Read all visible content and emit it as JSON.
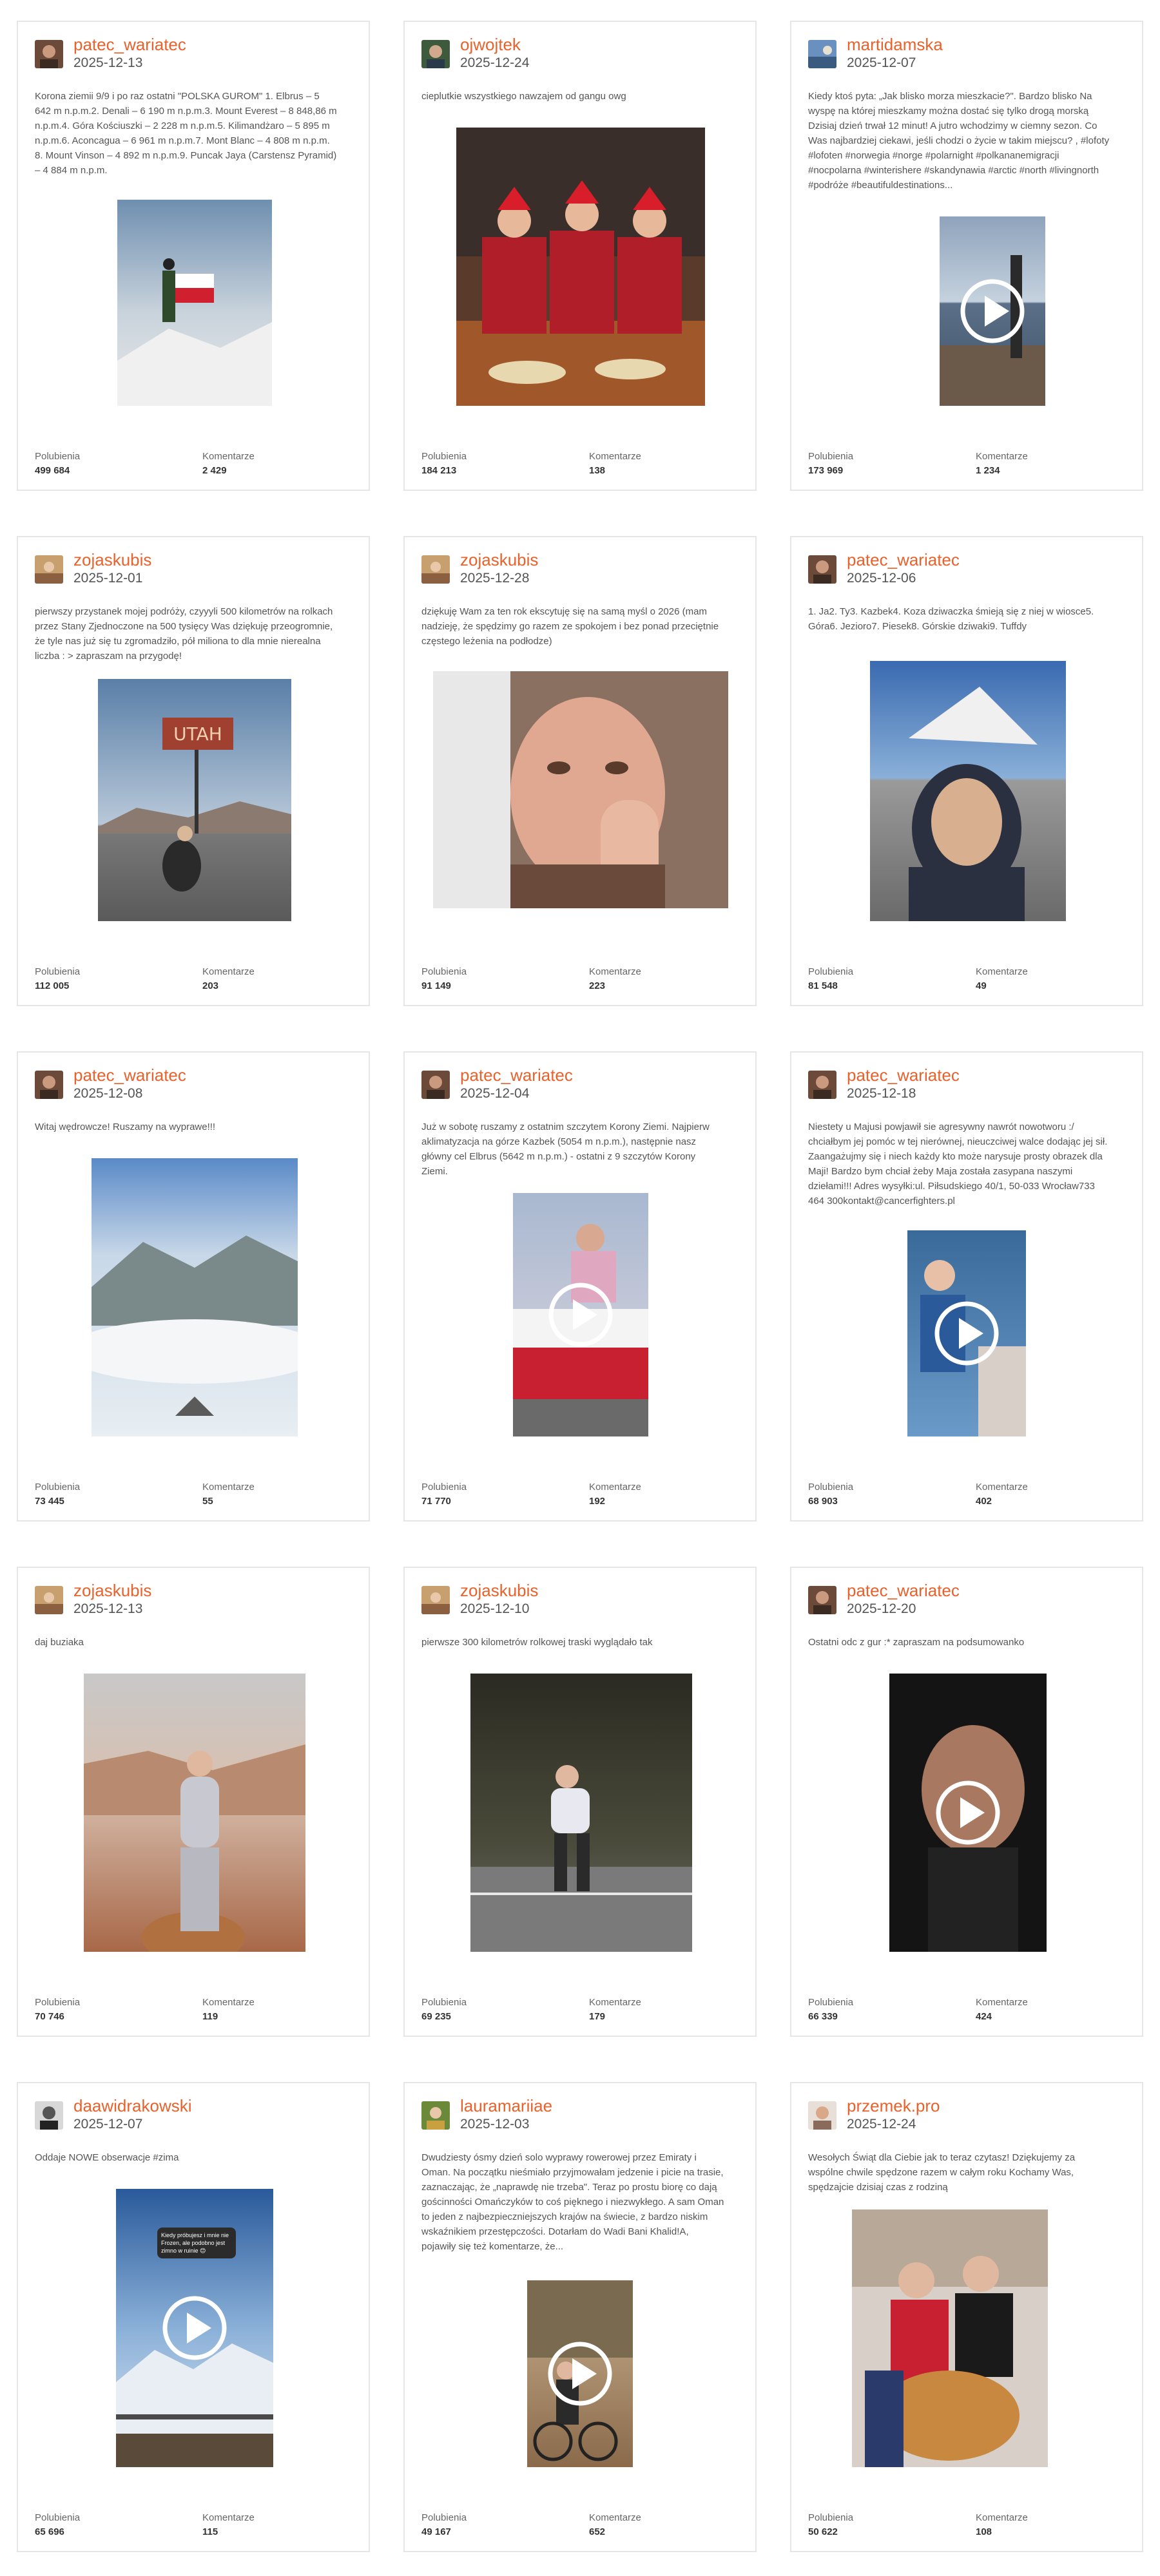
{
  "labels": {
    "likes": "Polubienia",
    "comments": "Komentarze"
  },
  "accent_color": "#e8622c",
  "play_icon": "play-icon",
  "posts": [
    {
      "username": "patec_wariatec",
      "date": "2025-12-13",
      "caption": "Korona ziemii 9/9 i po raz ostatni \"POLSKA GUROM\" 1. Elbrus – 5 642 m n.p.m.2. Denali – 6 190 m n.p.m.3. Mount Everest – 8 848,86 m n.p.m.4. Góra Kościuszki – 2 228 m n.p.m.5. Kilimandżaro – 5 895 m n.p.m.6. Aconcagua – 6 961 m n.p.m.7. Mont Blanc – 4 808 m n.p.m. 8. Mount Vinson – 4 892 m n.p.m.9. Puncak Jaya (Carstensz Pyramid) – 4 884 m n.p.m.",
      "likes": "499 684",
      "comments": "2 429"
    },
    {
      "username": "ojwojtek",
      "date": "2025-12-24",
      "caption": "cieplutkie wszystkiego nawzajem od gangu owg",
      "likes": "184 213",
      "comments": "138"
    },
    {
      "username": "martidamska",
      "date": "2025-12-07",
      "caption": "Kiedy ktoś pyta: „Jak blisko morza mieszkacie?\". Bardzo blisko Na wyspę na której mieszkamy można dostać się tylko drogą morską  Dzisiaj dzień trwał 12 minut! A jutro wchodzimy w ciemny sezon. Co Was najbardziej ciekawi, jeśli chodzi o życie w takim miejscu? , #lofoty #lofoten #norwegia #norge #polarnight #polkananemigracji #nocpolarna #winterishere #skandynawia #arctic #north #livingnorth #podróże #beautifuldestinations...",
      "likes": "173 969",
      "comments": "1 234"
    },
    {
      "username": "zojaskubis",
      "date": "2025-12-01",
      "caption": "pierwszy przystanek mojej podróży, czyyyli 500 kilometrów na rolkach przez Stany Zjednoczone na 500 tysięcy Was dziękuję przeogromnie, że tyle nas już się tu zgromadziło, pół miliona to dla mnie nierealna liczba : > zapraszam na przygodę!",
      "likes": "112 005",
      "comments": "203"
    },
    {
      "username": "zojaskubis",
      "date": "2025-12-28",
      "caption": "dziękuję Wam za ten rok ekscytuję się na samą myśl o 2026 (mam nadzieję, że spędzimy go razem ze spokojem i bez ponad przeciętnie częstego leżenia na podłodze)",
      "likes": "91 149",
      "comments": "223"
    },
    {
      "username": "patec_wariatec",
      "date": "2025-12-06",
      "caption": "1. Ja2. Ty3. Kazbek4. Koza dziwaczka śmieją się z niej w wiosce5. Góra6. Jezioro7. Piesek8. Górskie dziwaki9. Tuffdy",
      "likes": "81 548",
      "comments": "49"
    },
    {
      "username": "patec_wariatec",
      "date": "2025-12-08",
      "caption": "Witaj wędrowcze! Ruszamy na wyprawe!!!",
      "likes": "73 445",
      "comments": "55"
    },
    {
      "username": "patec_wariatec",
      "date": "2025-12-04",
      "caption": "Już w sobotę ruszamy z ostatnim szczytem Korony Ziemi. Najpierw aklimatyzacja na górze Kazbek (5054 m n.p.m.), następnie nasz główny cel Elbrus (5642 m n.p.m.) - ostatni z 9 szczytów Korony Ziemi.",
      "likes": "71 770",
      "comments": "192"
    },
    {
      "username": "patec_wariatec",
      "date": "2025-12-18",
      "caption": "Niestety u Majusi powjawił sie agresywny nawrót nowotworu :/ chciałbym jej pomóc w tej nierównej, nieuczciwej walce dodając jej sił. Zaangażujmy się i niech każdy kto może narysuje prosty obrazek dla Maji! Bardzo bym chciał żeby Maja została zasypana naszymi dziełami!!! Adres wysyłki:ul. Piłsudskiego 40/1, 50-033 Wrocław733 464 300kontakt@cancerfighters.pl",
      "likes": "68 903",
      "comments": "402"
    },
    {
      "username": "zojaskubis",
      "date": "2025-12-13",
      "caption": "daj buziaka",
      "likes": "70 746",
      "comments": "119"
    },
    {
      "username": "zojaskubis",
      "date": "2025-12-10",
      "caption": "pierwsze 300 kilometrów rolkowej traski wyglądało tak",
      "likes": "69 235",
      "comments": "179"
    },
    {
      "username": "patec_wariatec",
      "date": "2025-12-20",
      "caption": "Ostatni odc z gur :* zapraszam na podsumowanko",
      "likes": "66 339",
      "comments": "424"
    },
    {
      "username": "daawidrakowski",
      "date": "2025-12-07",
      "caption": "Oddaje NOWE obserwacje #zima",
      "overlay_text": "Kiedy próbujesz i mnie nie Frozen, ale podobno jest zimno w ruinie 😊",
      "likes": "65 696",
      "comments": "115"
    },
    {
      "username": "lauramariiae",
      "date": "2025-12-03",
      "caption": "Dwudziesty ósmy dzień solo wyprawy rowerowej przez Emiraty i Oman. Na początku nieśmiało przyjmowałam jedzenie i picie na trasie, zaznaczając, że „naprawdę nie trzeba\". Teraz po prostu biorę co dają gościnności Omańczyków to coś pięknego i niezwykłego. A sam Oman to jeden z najbezpieczniejszych krajów na świecie, z bardzo niskim wskaźnikiem przestępczości. Dotarłam do Wadi Bani Khalid!A, pojawiły się też komentarze, że...",
      "likes": "49 167",
      "comments": "652"
    },
    {
      "username": "przemek.pro",
      "date": "2025-12-24",
      "caption": "Wesołych Świąt dla Ciebie jak to teraz czytasz! Dziękujemy za wspólne chwile spędzone razem w całym roku  Kochamy Was, spędzajcie dzisiaj czas z rodziną",
      "likes": "50 622",
      "comments": "108"
    }
  ]
}
